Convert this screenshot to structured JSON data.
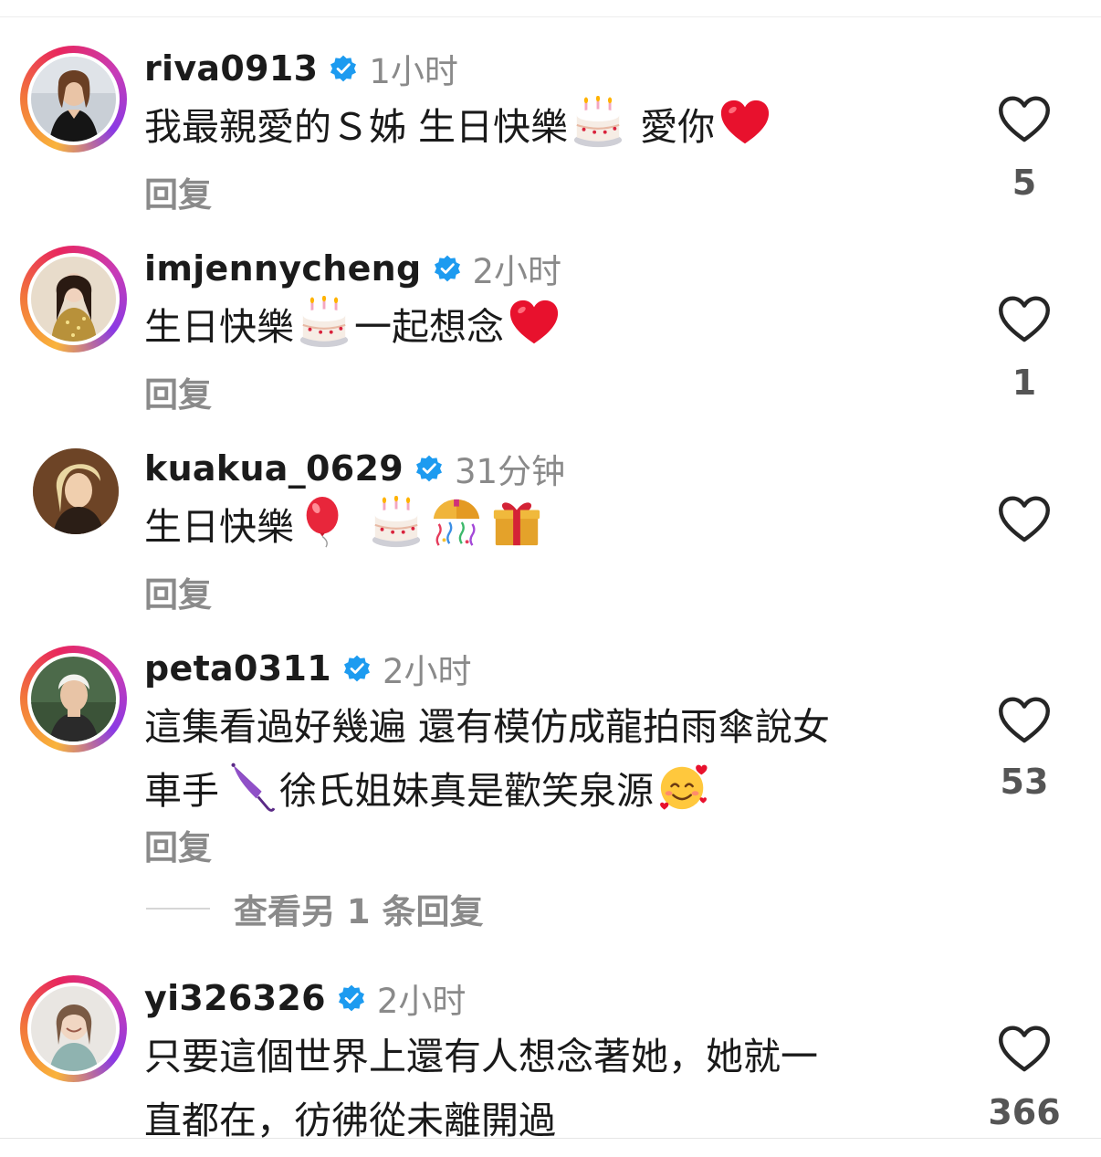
{
  "comments": [
    {
      "username": "riva0913",
      "time": "1小时",
      "text_parts": [
        "我最親愛的Ｓ姊 生日快樂",
        "愛你"
      ],
      "reply_label": "回复",
      "likes": "5",
      "avatar_icon": "woman-black-dress-photo",
      "emojis": [
        "birthday-cake-icon",
        "red-heart-icon"
      ]
    },
    {
      "username": "imjennycheng",
      "time": "2小时",
      "text_parts": [
        "生日快樂",
        "一起想念"
      ],
      "reply_label": "回复",
      "likes": "1",
      "avatar_icon": "woman-gold-dress-photo",
      "emojis": [
        "birthday-cake-icon",
        "red-heart-icon"
      ]
    },
    {
      "username": "kuakua_0629",
      "time": "31分钟",
      "text_parts": [
        "生日快樂"
      ],
      "reply_label": "回复",
      "likes": "",
      "avatar_icon": "person-blonde-hair-photo",
      "emojis": [
        "balloon-icon",
        "birthday-cake-icon",
        "confetti-ball-icon",
        "gift-icon"
      ]
    },
    {
      "username": "peta0311",
      "time": "2小时",
      "text_line1": "這集看過好幾遍 還有模仿成龍拍雨傘說女",
      "text_line2_parts": [
        "車手",
        "徐氏姐妹真是歡笑泉源"
      ],
      "reply_label": "回复",
      "likes": "53",
      "avatar_icon": "man-white-hair-photo",
      "emojis": [
        "umbrella-icon",
        "smiling-face-with-hearts-icon"
      ]
    },
    {
      "username": "yi326326",
      "time": "2小时",
      "text_line1": "只要這個世界上還有人想念著她，她就一",
      "text_line2": "直都在，彷彿從未離開過",
      "likes": "366",
      "avatar_icon": "woman-smiling-photo"
    }
  ],
  "more_replies_label": "查看另 1 条回复",
  "colors": {
    "verified_blue": "#1d9bf0",
    "secondary_text": "#8a8a8a",
    "primary_text": "#1a1a1a"
  }
}
